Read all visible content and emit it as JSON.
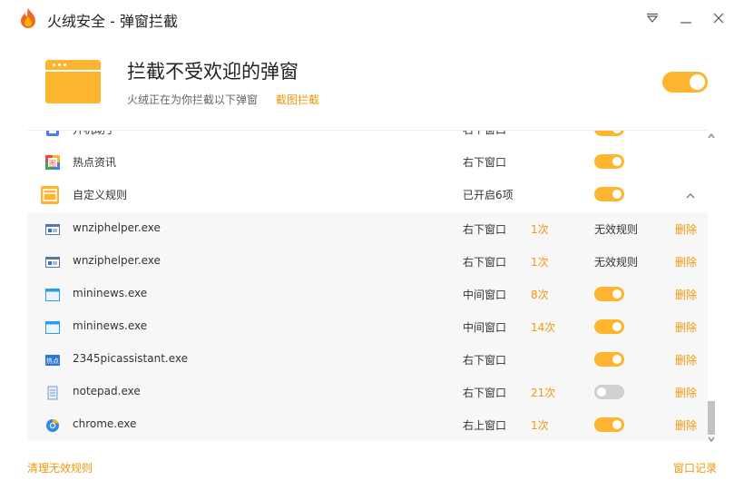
{
  "window": {
    "title": "火绒安全 - 弹窗拦截"
  },
  "header": {
    "title": "拦截不受欢迎的弹窗",
    "subtitle": "火绒正在为你拦截以下弹窗",
    "link": "截图拦截",
    "enabled": true
  },
  "rows": [
    {
      "kind": "app",
      "name": "开机助手",
      "position": "右下窗口",
      "count": "",
      "status": "toggle",
      "enabled": true,
      "action": "",
      "icon": "kaiji-app-icon"
    },
    {
      "kind": "app",
      "name": "热点资讯",
      "position": "右下窗口",
      "count": "",
      "status": "toggle",
      "enabled": true,
      "action": "",
      "icon": "hotnews-app-icon"
    },
    {
      "kind": "group",
      "name": "自定义规则",
      "position": "已开启6项",
      "count": "",
      "status": "toggle",
      "enabled": true,
      "action": "",
      "icon": "custom-rules-icon"
    },
    {
      "kind": "child",
      "name": "wnziphelper.exe",
      "position": "右下窗口",
      "count": "1次",
      "status": "text",
      "status_text": "无效规则",
      "action": "删除",
      "icon": "exe-window-icon"
    },
    {
      "kind": "child",
      "name": "wnziphelper.exe",
      "position": "右下窗口",
      "count": "1次",
      "status": "text",
      "status_text": "无效规则",
      "action": "删除",
      "icon": "exe-window-icon"
    },
    {
      "kind": "child",
      "name": "mininews.exe",
      "position": "中间窗口",
      "count": "8次",
      "status": "toggle",
      "enabled": true,
      "action": "删除",
      "icon": "mininews-window-icon"
    },
    {
      "kind": "child",
      "name": "mininews.exe",
      "position": "中间窗口",
      "count": "14次",
      "status": "toggle",
      "enabled": true,
      "action": "删除",
      "icon": "mininews-window-icon"
    },
    {
      "kind": "child",
      "name": "2345picassistant.exe",
      "position": "右下窗口",
      "count": "",
      "status": "toggle",
      "enabled": true,
      "action": "删除",
      "icon": "hotspot-badge-icon"
    },
    {
      "kind": "child",
      "name": "notepad.exe",
      "position": "右下窗口",
      "count": "21次",
      "status": "toggle",
      "enabled": false,
      "action": "删除",
      "icon": "notepad-icon"
    },
    {
      "kind": "child",
      "name": "chrome.exe",
      "position": "右上窗口",
      "count": "1次",
      "status": "toggle",
      "enabled": true,
      "action": "删除",
      "icon": "chrome-icon"
    }
  ],
  "footer": {
    "clear_invalid": "清理无效规则",
    "window_log": "窗口记录"
  },
  "colors": {
    "accent": "#fdb42e",
    "link": "#f0980a",
    "toggle_off": "#d0d0d0"
  }
}
